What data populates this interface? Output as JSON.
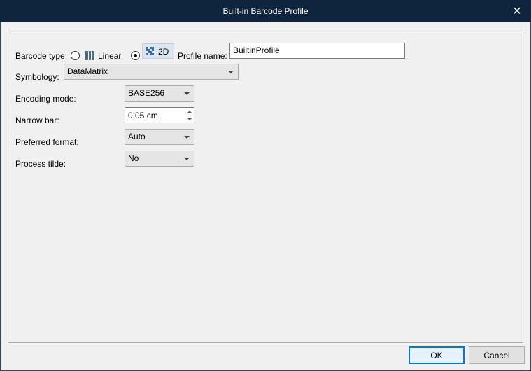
{
  "window": {
    "title": "Built-in Barcode Profile",
    "close_glyph": "✕"
  },
  "form": {
    "barcode_type_label": "Barcode type:",
    "linear_label": "Linear",
    "twod_label": "2D",
    "selected_type": "2D",
    "profile_name_label": "Profile name:",
    "profile_name_value": "BuiltinProfile",
    "symbology_label": "Symbology:",
    "symbology_value": "DataMatrix",
    "encoding_mode_label": "Encoding mode:",
    "encoding_mode_value": "BASE256",
    "narrow_bar_label": "Narrow bar:",
    "narrow_bar_value": "0.05 cm",
    "preferred_format_label": "Preferred format:",
    "preferred_format_value": "Auto",
    "process_tilde_label": "Process tilde:",
    "process_tilde_value": "No"
  },
  "buttons": {
    "ok_label": "OK",
    "cancel_label": "Cancel"
  },
  "icons": {
    "linear": "linear-barcode-icon",
    "twod": "2d-barcode-icon",
    "close": "close-icon"
  },
  "colors": {
    "titlebar": "#0f253d",
    "default_button_border": "#0078d7"
  }
}
